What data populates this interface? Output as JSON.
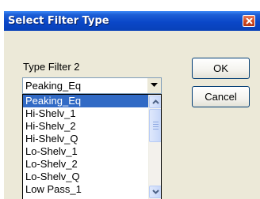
{
  "window": {
    "title": "Select Filter Type",
    "close_icon": "close-icon"
  },
  "colors": {
    "titlebar": "#0a47c8",
    "dialog_bg": "#ece9d8",
    "selection": "#316ac5",
    "close_button": "#d0491f"
  },
  "form": {
    "label": "Type Filter 2",
    "combo": {
      "selected_value": "Peaking_Eq",
      "arrow_icon": "chevron-down-icon"
    }
  },
  "buttons": {
    "ok_label": "OK",
    "cancel_label": "Cancel"
  },
  "dropdown": {
    "selected_index": 0,
    "items": [
      "Peaking_Eq",
      "Hi-Shelv_1",
      "Hi-Shelv_2",
      "Hi-Shelv_Q",
      "Lo-Shelv_1",
      "Lo-Shelv_2",
      "Lo-Shelv_Q",
      "Low Pass_1"
    ],
    "scrollbar": {
      "up_icon": "scroll-up-arrow-icon",
      "down_icon": "scroll-down-arrow-icon"
    }
  }
}
